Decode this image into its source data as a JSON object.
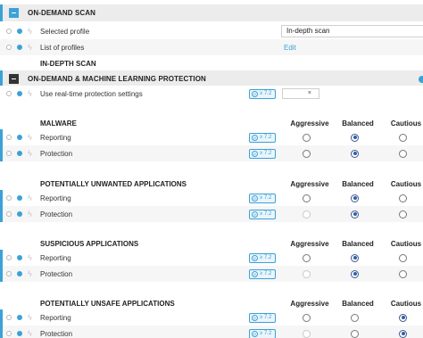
{
  "ondemand_scan": {
    "title": "ON-DEMAND SCAN",
    "selected_profile_label": "Selected profile",
    "selected_profile_value": "In-depth scan",
    "list_of_profiles_label": "List of profiles",
    "edit_link": "Edit",
    "subsection_title": "IN-DEPTH SCAN"
  },
  "ml_protection": {
    "title": "ON-DEMAND & MACHINE LEARNING PROTECTION",
    "realtime_label": "Use real-time protection settings",
    "realtime_clear": "×"
  },
  "badge": {
    "text": "≥ 7.2",
    "icon": "e"
  },
  "columns": {
    "aggressive": "Aggressive",
    "balanced": "Balanced",
    "cautious": "Cautious"
  },
  "groups": [
    {
      "title": "MALWARE",
      "rows": [
        {
          "label": "Reporting",
          "selected": "balanced",
          "aggressive_enabled": true
        },
        {
          "label": "Protection",
          "selected": "balanced",
          "aggressive_enabled": true
        }
      ]
    },
    {
      "title": "POTENTIALLY UNWANTED APPLICATIONS",
      "rows": [
        {
          "label": "Reporting",
          "selected": "balanced",
          "aggressive_enabled": true
        },
        {
          "label": "Protection",
          "selected": "balanced",
          "aggressive_enabled": false
        }
      ]
    },
    {
      "title": "SUSPICIOUS APPLICATIONS",
      "rows": [
        {
          "label": "Reporting",
          "selected": "balanced",
          "aggressive_enabled": true
        },
        {
          "label": "Protection",
          "selected": "balanced",
          "aggressive_enabled": false
        }
      ]
    },
    {
      "title": "POTENTIALLY UNSAFE APPLICATIONS",
      "rows": [
        {
          "label": "Reporting",
          "selected": "cautious",
          "aggressive_enabled": true
        },
        {
          "label": "Protection",
          "selected": "cautious",
          "aggressive_enabled": false
        }
      ]
    }
  ],
  "colors": {
    "accent": "#3ba2d7",
    "header_bg": "#ececec",
    "alt_row_bg": "#f6f6f6"
  },
  "icons": {
    "collapse": "minus-icon",
    "bolt": "lightning-icon",
    "clear": "close-icon"
  }
}
